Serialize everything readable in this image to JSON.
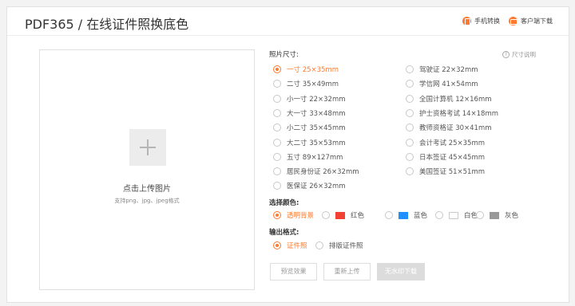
{
  "header": {
    "title": "PDF365 / 在线证件照换底色",
    "links": [
      {
        "label": "手机转换",
        "icon": "phone-icon"
      },
      {
        "label": "客户端下载",
        "icon": "desktop-icon"
      }
    ]
  },
  "uploader": {
    "label": "点击上传图片",
    "hint": "支持png、jpg、jpeg格式"
  },
  "size": {
    "label": "照片尺寸:",
    "help": "尺寸说明",
    "options_left": [
      {
        "label": "一寸 25×35mm",
        "selected": true
      },
      {
        "label": "二寸 35×49mm"
      },
      {
        "label": "小一寸 22×32mm"
      },
      {
        "label": "大一寸 33×48mm"
      },
      {
        "label": "小二寸 35×45mm"
      },
      {
        "label": "大二寸 35×53mm"
      },
      {
        "label": "五寸 89×127mm"
      },
      {
        "label": "居民身份证 26×32mm"
      },
      {
        "label": "医保证 26×32mm"
      }
    ],
    "options_right": [
      {
        "label": "驾驶证 22×32mm"
      },
      {
        "label": "学信网 41×54mm"
      },
      {
        "label": "全国计算机 12×16mm"
      },
      {
        "label": "护士资格考试 14×18mm"
      },
      {
        "label": "教师资格证 30×41mm"
      },
      {
        "label": "会计考试 25×35mm"
      },
      {
        "label": "日本签证 45×45mm"
      },
      {
        "label": "美国签证 51×51mm"
      }
    ]
  },
  "color": {
    "label": "选择颜色:",
    "options": [
      {
        "label": "透明背景",
        "selected": true,
        "swatch": null
      },
      {
        "label": "红色",
        "swatch": "#f04134"
      },
      {
        "label": "蓝色",
        "swatch": "#1e90ff"
      },
      {
        "label": "白色",
        "swatch": "#ffffff"
      },
      {
        "label": "灰色",
        "swatch": "#999999"
      }
    ]
  },
  "format": {
    "label": "输出格式:",
    "options": [
      {
        "label": "证件照",
        "selected": true
      },
      {
        "label": "排版证件照"
      }
    ]
  },
  "actions": {
    "preview": "预览效果",
    "reupload": "重新上传",
    "download": "无水印下载"
  },
  "accent_color": "#ff7a2e"
}
